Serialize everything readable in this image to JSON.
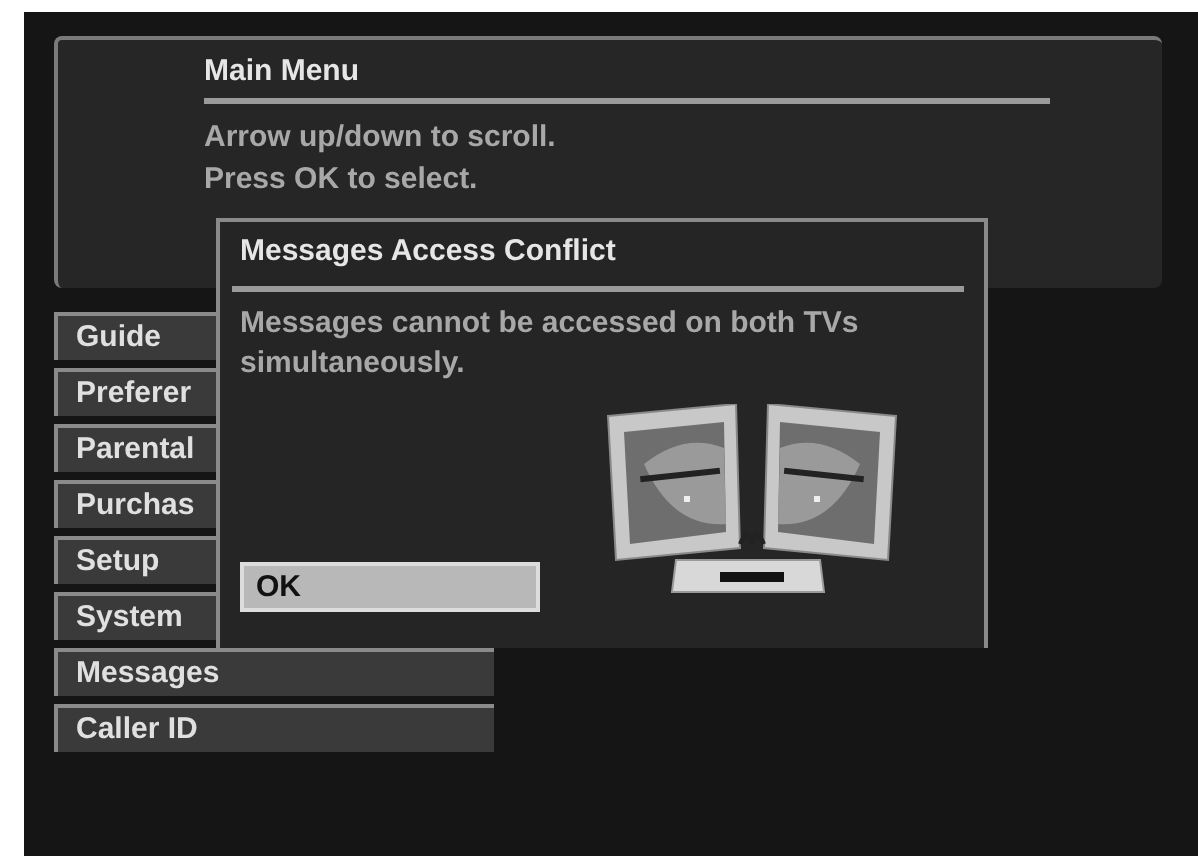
{
  "main_menu": {
    "title": "Main Menu",
    "instructions": [
      "Arrow up/down to scroll.",
      "Press OK to select."
    ]
  },
  "menu_items": [
    {
      "label": "Guide"
    },
    {
      "label": "Preferer"
    },
    {
      "label": "Parental"
    },
    {
      "label": "Purchas"
    },
    {
      "label": "Setup"
    },
    {
      "label": "System"
    },
    {
      "label": "Messages"
    },
    {
      "label": "Caller ID"
    }
  ],
  "dialog": {
    "title": "Messages Access Conflict",
    "message": "Messages cannot be accessed on both TVs simultaneously.",
    "buttons": [
      "OK"
    ]
  }
}
